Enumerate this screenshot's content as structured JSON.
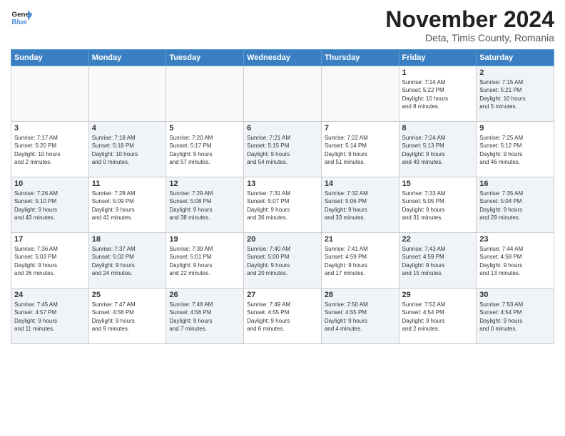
{
  "header": {
    "logo_general": "General",
    "logo_blue": "Blue",
    "month_title": "November 2024",
    "location": "Deta, Timis County, Romania"
  },
  "weekdays": [
    "Sunday",
    "Monday",
    "Tuesday",
    "Wednesday",
    "Thursday",
    "Friday",
    "Saturday"
  ],
  "weeks": [
    [
      {
        "day": "",
        "info": ""
      },
      {
        "day": "",
        "info": ""
      },
      {
        "day": "",
        "info": ""
      },
      {
        "day": "",
        "info": ""
      },
      {
        "day": "",
        "info": ""
      },
      {
        "day": "1",
        "info": "Sunrise: 7:14 AM\nSunset: 5:22 PM\nDaylight: 10 hours\nand 8 minutes."
      },
      {
        "day": "2",
        "info": "Sunrise: 7:15 AM\nSunset: 5:21 PM\nDaylight: 10 hours\nand 5 minutes."
      }
    ],
    [
      {
        "day": "3",
        "info": "Sunrise: 7:17 AM\nSunset: 5:20 PM\nDaylight: 10 hours\nand 2 minutes."
      },
      {
        "day": "4",
        "info": "Sunrise: 7:18 AM\nSunset: 5:18 PM\nDaylight: 10 hours\nand 0 minutes."
      },
      {
        "day": "5",
        "info": "Sunrise: 7:20 AM\nSunset: 5:17 PM\nDaylight: 9 hours\nand 57 minutes."
      },
      {
        "day": "6",
        "info": "Sunrise: 7:21 AM\nSunset: 5:15 PM\nDaylight: 9 hours\nand 54 minutes."
      },
      {
        "day": "7",
        "info": "Sunrise: 7:22 AM\nSunset: 5:14 PM\nDaylight: 9 hours\nand 51 minutes."
      },
      {
        "day": "8",
        "info": "Sunrise: 7:24 AM\nSunset: 5:13 PM\nDaylight: 9 hours\nand 49 minutes."
      },
      {
        "day": "9",
        "info": "Sunrise: 7:25 AM\nSunset: 5:12 PM\nDaylight: 9 hours\nand 46 minutes."
      }
    ],
    [
      {
        "day": "10",
        "info": "Sunrise: 7:26 AM\nSunset: 5:10 PM\nDaylight: 9 hours\nand 43 minutes."
      },
      {
        "day": "11",
        "info": "Sunrise: 7:28 AM\nSunset: 5:09 PM\nDaylight: 9 hours\nand 41 minutes."
      },
      {
        "day": "12",
        "info": "Sunrise: 7:29 AM\nSunset: 5:08 PM\nDaylight: 9 hours\nand 38 minutes."
      },
      {
        "day": "13",
        "info": "Sunrise: 7:31 AM\nSunset: 5:07 PM\nDaylight: 9 hours\nand 36 minutes."
      },
      {
        "day": "14",
        "info": "Sunrise: 7:32 AM\nSunset: 5:06 PM\nDaylight: 9 hours\nand 33 minutes."
      },
      {
        "day": "15",
        "info": "Sunrise: 7:33 AM\nSunset: 5:05 PM\nDaylight: 9 hours\nand 31 minutes."
      },
      {
        "day": "16",
        "info": "Sunrise: 7:35 AM\nSunset: 5:04 PM\nDaylight: 9 hours\nand 29 minutes."
      }
    ],
    [
      {
        "day": "17",
        "info": "Sunrise: 7:36 AM\nSunset: 5:03 PM\nDaylight: 9 hours\nand 26 minutes."
      },
      {
        "day": "18",
        "info": "Sunrise: 7:37 AM\nSunset: 5:02 PM\nDaylight: 9 hours\nand 24 minutes."
      },
      {
        "day": "19",
        "info": "Sunrise: 7:39 AM\nSunset: 5:01 PM\nDaylight: 9 hours\nand 22 minutes."
      },
      {
        "day": "20",
        "info": "Sunrise: 7:40 AM\nSunset: 5:00 PM\nDaylight: 9 hours\nand 20 minutes."
      },
      {
        "day": "21",
        "info": "Sunrise: 7:41 AM\nSunset: 4:59 PM\nDaylight: 9 hours\nand 17 minutes."
      },
      {
        "day": "22",
        "info": "Sunrise: 7:43 AM\nSunset: 4:59 PM\nDaylight: 9 hours\nand 15 minutes."
      },
      {
        "day": "23",
        "info": "Sunrise: 7:44 AM\nSunset: 4:58 PM\nDaylight: 9 hours\nand 13 minutes."
      }
    ],
    [
      {
        "day": "24",
        "info": "Sunrise: 7:45 AM\nSunset: 4:57 PM\nDaylight: 9 hours\nand 11 minutes."
      },
      {
        "day": "25",
        "info": "Sunrise: 7:47 AM\nSunset: 4:56 PM\nDaylight: 9 hours\nand 9 minutes."
      },
      {
        "day": "26",
        "info": "Sunrise: 7:48 AM\nSunset: 4:56 PM\nDaylight: 9 hours\nand 7 minutes."
      },
      {
        "day": "27",
        "info": "Sunrise: 7:49 AM\nSunset: 4:55 PM\nDaylight: 9 hours\nand 6 minutes."
      },
      {
        "day": "28",
        "info": "Sunrise: 7:50 AM\nSunset: 4:55 PM\nDaylight: 9 hours\nand 4 minutes."
      },
      {
        "day": "29",
        "info": "Sunrise: 7:52 AM\nSunset: 4:54 PM\nDaylight: 9 hours\nand 2 minutes."
      },
      {
        "day": "30",
        "info": "Sunrise: 7:53 AM\nSunset: 4:54 PM\nDaylight: 9 hours\nand 0 minutes."
      }
    ]
  ]
}
